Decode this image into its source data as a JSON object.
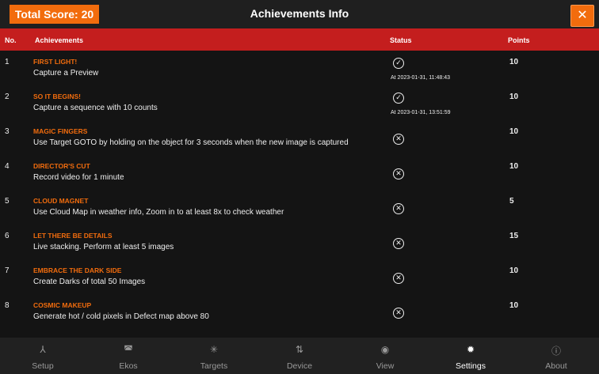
{
  "header": {
    "score": "Total Score: 20",
    "title": "Achievements Info",
    "close": "✕"
  },
  "columns": {
    "no": "No.",
    "achievements": "Achievements",
    "status": "Status",
    "points": "Points"
  },
  "rows": [
    {
      "no": "1",
      "name": "FIRST LIGHT!",
      "desc": "Capture a Preview",
      "done": true,
      "time": "At 2023-01-31, 11:48:43",
      "points": "10"
    },
    {
      "no": "2",
      "name": "SO IT BEGINS!",
      "desc": "Capture a sequence with 10 counts",
      "done": true,
      "time": "At 2023-01-31, 13:51:59",
      "points": "10"
    },
    {
      "no": "3",
      "name": "MAGIC FINGERS",
      "desc": "Use Target GOTO by holding on the object for 3 seconds when the new image is captured",
      "done": false,
      "points": "10"
    },
    {
      "no": "4",
      "name": "DIRECTOR'S CUT",
      "desc": "Record video for 1 minute",
      "done": false,
      "points": "10"
    },
    {
      "no": "5",
      "name": "CLOUD MAGNET",
      "desc": "Use Cloud Map in weather info, Zoom in to at least 8x to check weather",
      "done": false,
      "points": "5"
    },
    {
      "no": "6",
      "name": "LET THERE BE DETAILS",
      "desc": "Live stacking. Perform at least 5 images",
      "done": false,
      "points": "15"
    },
    {
      "no": "7",
      "name": "EMBRACE THE DARK SIDE",
      "desc": "Create Darks of total 50 Images",
      "done": false,
      "points": "10"
    },
    {
      "no": "8",
      "name": "COSMIC MAKEUP",
      "desc": "Generate hot / cold pixels in Defect map above 80",
      "done": false,
      "points": "10"
    }
  ],
  "nav": [
    {
      "label": "Setup",
      "icon": "setup-icon",
      "glyph": "⅄"
    },
    {
      "label": "Ekos",
      "icon": "ekos-icon",
      "glyph": "◚"
    },
    {
      "label": "Targets",
      "icon": "targets-icon",
      "glyph": "✳"
    },
    {
      "label": "Device",
      "icon": "device-icon",
      "glyph": "⇅"
    },
    {
      "label": "View",
      "icon": "eye-icon",
      "glyph": "◉"
    },
    {
      "label": "Settings",
      "icon": "gear-icon",
      "glyph": "✹",
      "active": true
    },
    {
      "label": "About",
      "icon": "info-icon",
      "glyph": "ⓘ"
    }
  ],
  "colors": {
    "accent": "#f26c0d",
    "header_bar": "#c41e1e"
  }
}
